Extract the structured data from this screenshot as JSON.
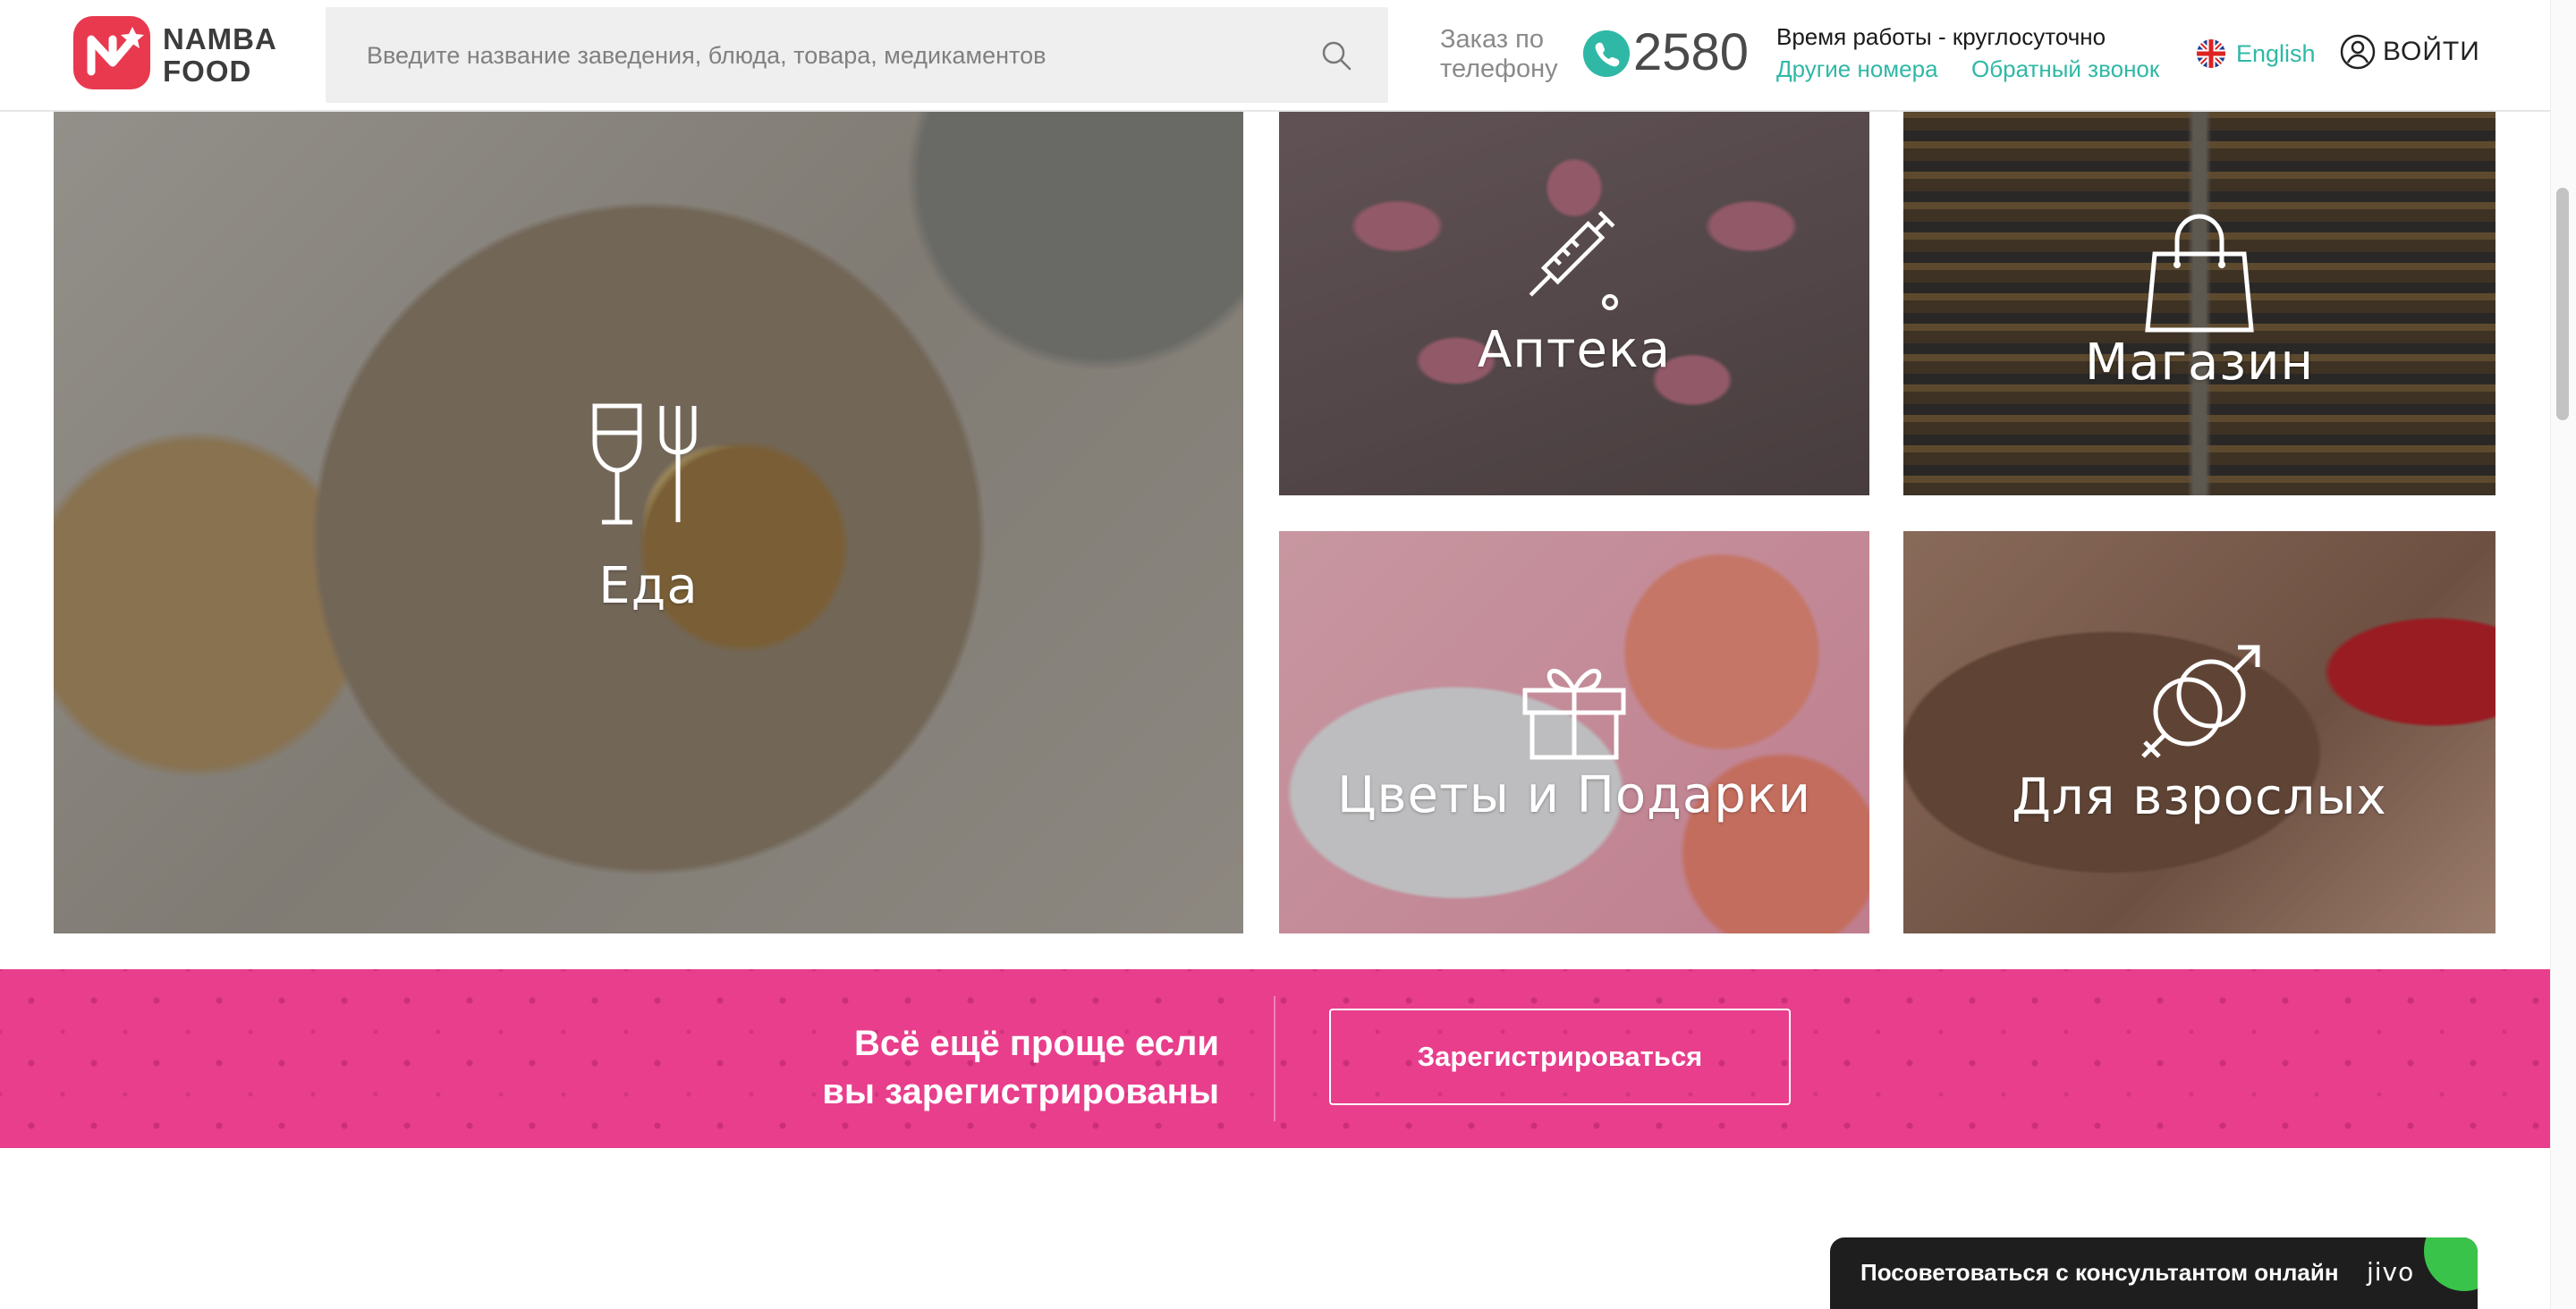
{
  "header": {
    "logo_text": "NAMBA FOOD",
    "search_placeholder": "Введите название заведения, блюда, товара, медикаментов",
    "order_label": "Заказ по телефону",
    "phone": "2580",
    "hours": "Время работы - круглосуточно",
    "other_numbers": "Другие номера",
    "callback": "Обратный звонок",
    "language": "English",
    "login": "ВОЙТИ"
  },
  "categories": [
    {
      "label": "Еда",
      "icon": "wine-glass-fork-icon"
    },
    {
      "label": "Аптека",
      "icon": "syringe-icon"
    },
    {
      "label": "Магазин",
      "icon": "shopping-bag-icon"
    },
    {
      "label": "Цветы и Подарки",
      "icon": "gift-icon"
    },
    {
      "label": "Для взрослых",
      "icon": "gender-symbols-icon"
    }
  ],
  "banner": {
    "text_line1": "Всё ещё проще если",
    "text_line2": "вы зарегистрированы",
    "button": "Зарегистрироваться"
  },
  "chat": {
    "text": "Посоветоваться с консультантом онлайн",
    "brand": "jivo"
  },
  "colors": {
    "accent_teal": "#2fb8a6",
    "banner_pink": "#e83e8c",
    "logo_red": "#e8394f"
  }
}
